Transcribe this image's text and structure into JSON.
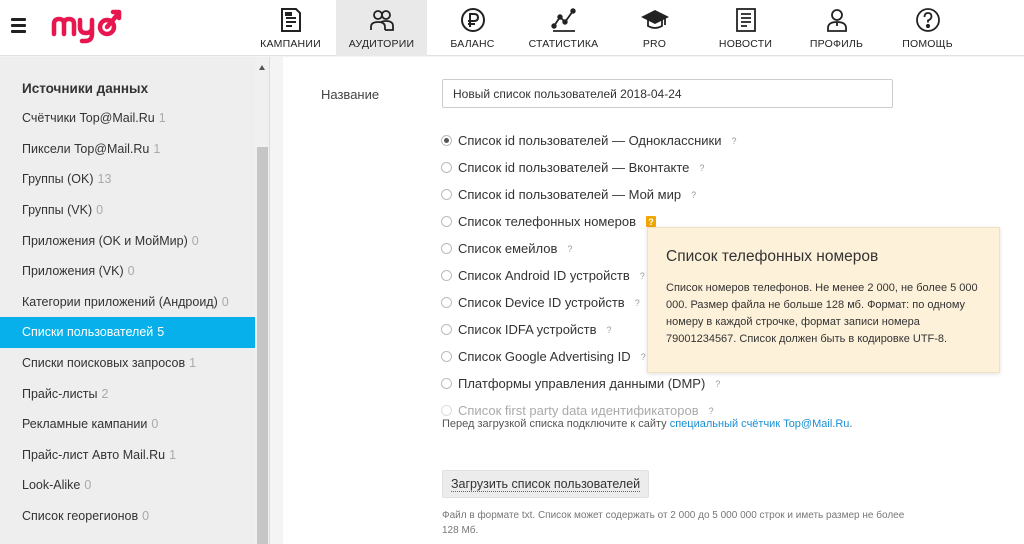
{
  "nav": {
    "items": [
      {
        "label": "КАМПАНИИ",
        "icon": "campaigns-icon"
      },
      {
        "label": "АУДИТОРИИ",
        "icon": "audiences-icon",
        "active": true
      },
      {
        "label": "БАЛАНС",
        "icon": "ruble-icon"
      },
      {
        "label": "СТАТИСТИКА",
        "icon": "chart-icon"
      },
      {
        "label": "PRO",
        "icon": "graduation-cap-icon"
      },
      {
        "label": "НОВОСТИ",
        "icon": "news-icon"
      },
      {
        "label": "ПРОФИЛЬ",
        "icon": "profile-icon"
      },
      {
        "label": "ПОМОЩЬ",
        "icon": "help-icon"
      }
    ]
  },
  "sidebar": {
    "title": "Источники данных",
    "items": [
      {
        "label": "Счётчики Top@Mail.Ru",
        "count": "1"
      },
      {
        "label": "Пиксели Top@Mail.Ru",
        "count": "1"
      },
      {
        "label": "Группы (OK)",
        "count": "13"
      },
      {
        "label": "Группы (VK)",
        "count": "0"
      },
      {
        "label": "Приложения (OK и МойМир)",
        "count": "0"
      },
      {
        "label": "Приложения (VK)",
        "count": "0"
      },
      {
        "label": "Категории приложений (Андроид)",
        "count": "0"
      },
      {
        "label": "Списки пользователей",
        "count": "5"
      },
      {
        "label": "Списки поисковых запросов",
        "count": "1"
      },
      {
        "label": "Прайс-листы",
        "count": "2"
      },
      {
        "label": "Рекламные кампании",
        "count": "0"
      },
      {
        "label": "Прайс-лист Авто Mail.Ru",
        "count": "1"
      },
      {
        "label": "Look-Alike",
        "count": "0"
      },
      {
        "label": "Список георегионов",
        "count": "0"
      }
    ]
  },
  "form": {
    "name_label": "Название",
    "name_value": "Новый список пользователей 2018-04-24",
    "options": [
      {
        "label": "Список id пользователей — Одноклассники",
        "help": "?"
      },
      {
        "label": "Список id пользователей — Вконтакте",
        "help": "?"
      },
      {
        "label": "Список id пользователей — Мой мир",
        "help": "?"
      },
      {
        "label": "Список телефонных номеров",
        "help": "?"
      },
      {
        "label": "Список емейлов",
        "help": "?"
      },
      {
        "label": "Список Android ID устройств",
        "help": "?"
      },
      {
        "label": "Список Device ID устройств",
        "help": "?"
      },
      {
        "label": "Список IDFA устройств",
        "help": "?"
      },
      {
        "label": "Список Google Advertising ID",
        "help": "?"
      },
      {
        "label": "Платформы управления данными (DMP)",
        "help": "?"
      },
      {
        "label": "Список first party data идентификаторов",
        "help": "?"
      }
    ],
    "notice_text": "Перед загрузкой списка подключите к сайту ",
    "notice_link": "специальный счётчик Top@Mail.Ru",
    "notice_end": ".",
    "upload_label": "Загрузить список пользователей",
    "upload_hint": "Файл в формате txt. Список может содержать от 2 000 до 5 000 000 строк и иметь размер не более 128 Мб."
  },
  "tooltip": {
    "title": "Список телефонных номеров",
    "body": "Список номеров телефонов. Не менее 2 000, не более 5 000 000. Размер файла не больше 128 мб. Формат: по одному номеру в каждой строчке, формат записи номера 79001234567. Список должен быть в кодировке UTF-8."
  },
  "colors": {
    "accent": "#07b0ea",
    "logo": "#e8164f",
    "tooltip_bg": "#fdf1da",
    "help_highlight": "#f2a600"
  }
}
